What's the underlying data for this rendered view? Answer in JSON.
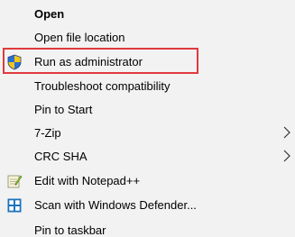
{
  "menu": {
    "items": [
      {
        "label": "Open"
      },
      {
        "label": "Open file location"
      },
      {
        "label": "Run as administrator",
        "icon": "uac-shield-icon"
      },
      {
        "label": "Troubleshoot compatibility"
      },
      {
        "label": "Pin to Start"
      },
      {
        "label": "7-Zip"
      },
      {
        "label": "CRC SHA"
      },
      {
        "label": "Edit with Notepad++",
        "icon": "notepad-plus-plus-icon"
      },
      {
        "label": "Scan with Windows Defender...",
        "icon": "windows-defender-icon"
      },
      {
        "label": "Pin to taskbar"
      }
    ]
  },
  "colors": {
    "menu_background": "#f2f2f2",
    "highlight_border": "#e03a3e",
    "text": "#000000"
  }
}
